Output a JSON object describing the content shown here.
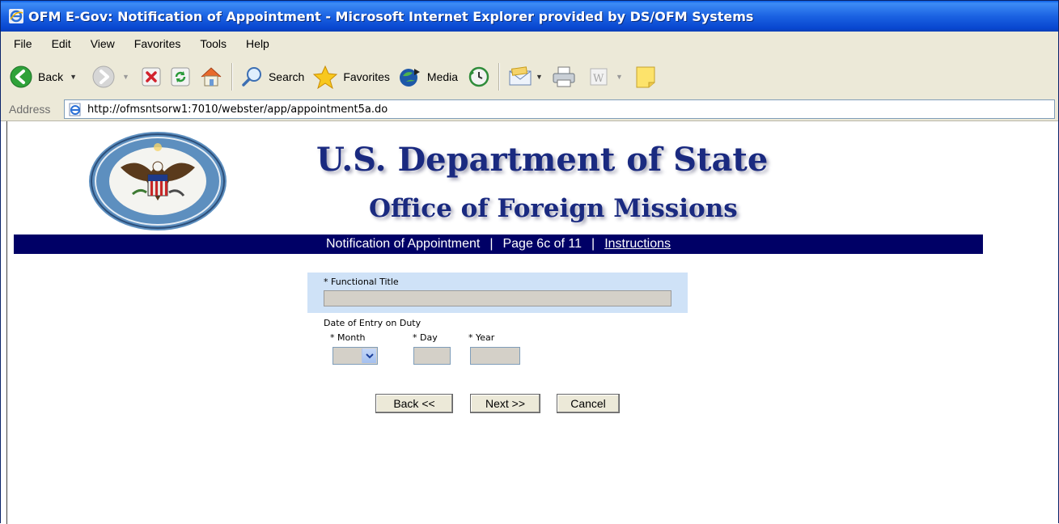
{
  "window": {
    "title": "OFM E-Gov: Notification of Appointment - Microsoft Internet Explorer provided by DS/OFM Systems"
  },
  "menu": [
    "File",
    "Edit",
    "View",
    "Favorites",
    "Tools",
    "Help"
  ],
  "toolbar": {
    "back_label": "Back",
    "search_label": "Search",
    "favorites_label": "Favorites",
    "media_label": "Media"
  },
  "address": {
    "label": "Address",
    "url": "http://ofmsntsorw1:7010/webster/app/appointment5a.do"
  },
  "page": {
    "heading": "U.S. Department of State",
    "subheading": "Office of Foreign Missions",
    "nav": {
      "section": "Notification of Appointment",
      "separator": "|",
      "page_info": "Page 6c of 11",
      "instructions_link": "Instructions"
    },
    "form": {
      "functional_title_label": "* Functional Title",
      "functional_title_value": "",
      "date_label": "Date of Entry on Duty",
      "month_label": "* Month",
      "day_label": "* Day",
      "year_label": "* Year",
      "month_value": "",
      "day_value": "",
      "year_value": ""
    },
    "buttons": {
      "back": "Back <<",
      "next": "Next >>",
      "cancel": "Cancel"
    }
  }
}
